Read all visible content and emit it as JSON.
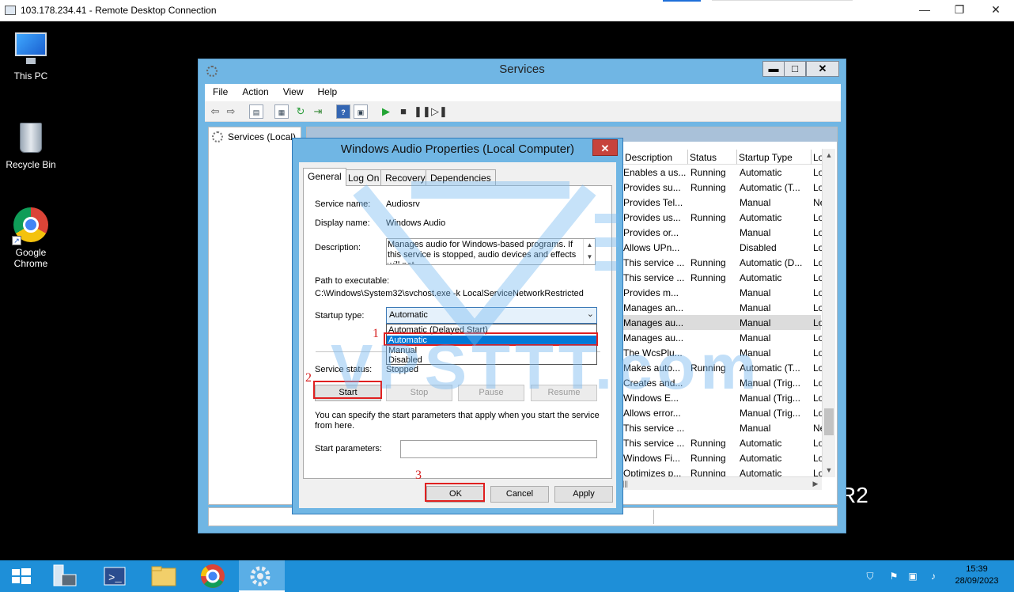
{
  "rdp": {
    "title": "103.178.234.41 - Remote Desktop Connection",
    "minimize": "—",
    "restore": "❐",
    "close": "✕"
  },
  "desktop": {
    "icons": [
      {
        "label": "This PC",
        "icon": "this-pc-icon"
      },
      {
        "label": "Recycle Bin",
        "icon": "recycle-bin-icon"
      },
      {
        "label": "Google Chrome",
        "icon": "google-chrome-icon"
      }
    ],
    "edition_fragment": "R2"
  },
  "services": {
    "title": "Services",
    "controls": {
      "minimize": "▬",
      "maximize": "□",
      "close": "✕"
    },
    "menu": [
      "File",
      "Action",
      "View",
      "Help"
    ],
    "tree_item": "Services (Local)",
    "columns": [
      "Description",
      "Status",
      "Startup Type",
      "Lo"
    ],
    "rows": [
      {
        "description": "Enables a us...",
        "status": "Running",
        "startup": "Automatic",
        "logon": "Lo"
      },
      {
        "description": "Provides su...",
        "status": "Running",
        "startup": "Automatic (T...",
        "logon": "Lo"
      },
      {
        "description": "Provides Tel...",
        "status": "",
        "startup": "Manual",
        "logon": "Ne"
      },
      {
        "description": "Provides us...",
        "status": "Running",
        "startup": "Automatic",
        "logon": "Lo"
      },
      {
        "description": "Provides or...",
        "status": "",
        "startup": "Manual",
        "logon": "Lo"
      },
      {
        "description": "Allows UPn...",
        "status": "",
        "startup": "Disabled",
        "logon": "Lo"
      },
      {
        "description": "This service ...",
        "status": "Running",
        "startup": "Automatic (D...",
        "logon": "Lo"
      },
      {
        "description": "This service ...",
        "status": "Running",
        "startup": "Automatic",
        "logon": "Lo"
      },
      {
        "description": "Provides m...",
        "status": "",
        "startup": "Manual",
        "logon": "Lo"
      },
      {
        "description": "Manages an...",
        "status": "",
        "startup": "Manual",
        "logon": "Lo"
      },
      {
        "description": "Manages au...",
        "status": "",
        "startup": "Manual",
        "logon": "Lo",
        "selected": true
      },
      {
        "description": "Manages au...",
        "status": "",
        "startup": "Manual",
        "logon": "Lo"
      },
      {
        "description": "The WcsPlu...",
        "status": "",
        "startup": "Manual",
        "logon": "Lo"
      },
      {
        "description": "Makes auto...",
        "status": "Running",
        "startup": "Automatic (T...",
        "logon": "Lo"
      },
      {
        "description": "Creates and...",
        "status": "",
        "startup": "Manual (Trig...",
        "logon": "Lo"
      },
      {
        "description": "Windows E...",
        "status": "",
        "startup": "Manual (Trig...",
        "logon": "Lo"
      },
      {
        "description": "Allows error...",
        "status": "",
        "startup": "Manual (Trig...",
        "logon": "Lo"
      },
      {
        "description": "This service ...",
        "status": "",
        "startup": "Manual",
        "logon": "Ne"
      },
      {
        "description": "This service ...",
        "status": "Running",
        "startup": "Automatic",
        "logon": "Lo"
      },
      {
        "description": "Windows Fi...",
        "status": "Running",
        "startup": "Automatic",
        "logon": "Lo"
      },
      {
        "description": "Optimizes p...",
        "status": "Running",
        "startup": "Automatic",
        "logon": "Lo"
      }
    ]
  },
  "dialog": {
    "title": "Windows Audio Properties (Local Computer)",
    "close": "✕",
    "tabs": [
      "General",
      "Log On",
      "Recovery",
      "Dependencies"
    ],
    "service_name_label": "Service name:",
    "service_name": "Audiosrv",
    "display_name_label": "Display name:",
    "display_name": "Windows Audio",
    "description_label": "Description:",
    "description": "Manages audio for Windows-based programs.  If this service is stopped, audio devices and effects will not",
    "path_label": "Path to executable:",
    "path": "C:\\Windows\\System32\\svchost.exe -k LocalServiceNetworkRestricted",
    "startup_type_label": "Startup type:",
    "startup_type_value": "Automatic",
    "startup_options": [
      "Automatic (Delayed Start)",
      "Automatic",
      "Manual",
      "Disabled"
    ],
    "highlighted_option": "Automatic",
    "service_status_label": "Service status:",
    "service_status": "Stopped",
    "buttons": {
      "start": "Start",
      "stop": "Stop",
      "pause": "Pause",
      "resume": "Resume"
    },
    "hint": "You can specify the start parameters that apply when you start the service from here.",
    "start_params_label": "Start parameters:",
    "start_params_value": "",
    "ok": "OK",
    "cancel": "Cancel",
    "apply": "Apply"
  },
  "annotations": {
    "step1": "1",
    "step2": "2",
    "step3": "3"
  },
  "watermark": "VPSTTT.com",
  "taskbar": {
    "items": [
      "start-button",
      "server-manager-icon",
      "powershell-icon",
      "file-explorer-icon",
      "google-chrome-icon",
      "services-icon"
    ],
    "time": "15:39",
    "date": "28/09/2023"
  },
  "colors": {
    "window_frame": "#70b6e4",
    "taskbar": "#1e8fd8",
    "highlight": "#0078d7",
    "annotation_red": "#e02020"
  }
}
